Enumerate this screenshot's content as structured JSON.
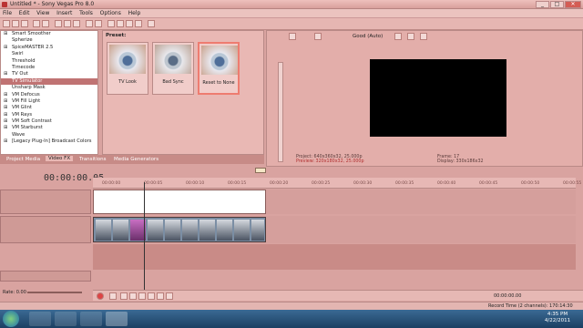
{
  "window": {
    "title": "Untitled * - Sony Vegas Pro 8.0",
    "minimize": "_",
    "maximize": "□",
    "close": "✕"
  },
  "menu": [
    "File",
    "Edit",
    "View",
    "Insert",
    "Tools",
    "Options",
    "Help"
  ],
  "effects_list": [
    "Smart Smoother",
    "Spherize",
    "SpiceMASTER 2.5",
    "Swirl",
    "Threshold",
    "Timecode",
    "TV Out",
    "TV Simulator",
    "Unsharp Mask",
    "VM Defocus",
    "VM Fill Light",
    "VM Glint",
    "VM Rays",
    "VM Soft Contrast",
    "VM Starburst",
    "Wave",
    "[Legacy Plug-In] Broadcast Colors"
  ],
  "effects_selected": "TV Simulator",
  "preset": {
    "label": "Preset:",
    "items": [
      "TV Look",
      "Bad Sync",
      "Reset to None"
    ]
  },
  "tabs": [
    "Project Media",
    "Video FX",
    "Transitions",
    "Media Generators"
  ],
  "preview": {
    "quality": "Good (Auto)",
    "project": "Project: 640x360x32, 25.000p",
    "preview": "Preview: 320x180x32, 25.000p",
    "frame": "Frame: 17",
    "display": "Display: 330x186x32"
  },
  "timeline": {
    "timecode": "00:00:00.05",
    "ruler": [
      "00:00:00",
      "00:00:05",
      "00:00:10",
      "00:00:15",
      "00:00:20",
      "00:00:25",
      "00:00:30",
      "00:00:35",
      "00:00:40",
      "00:00:45",
      "00:00:50",
      "00:00:55"
    ],
    "rate": "Rate: 0.00",
    "end_time": "00:00:00.00"
  },
  "status": {
    "record": "Record Time (2 channels): 170:14:30"
  },
  "clock": {
    "time": "4:35 PM",
    "date": "4/22/2011"
  },
  "icons": {
    "start": "windows-orb-icon"
  }
}
